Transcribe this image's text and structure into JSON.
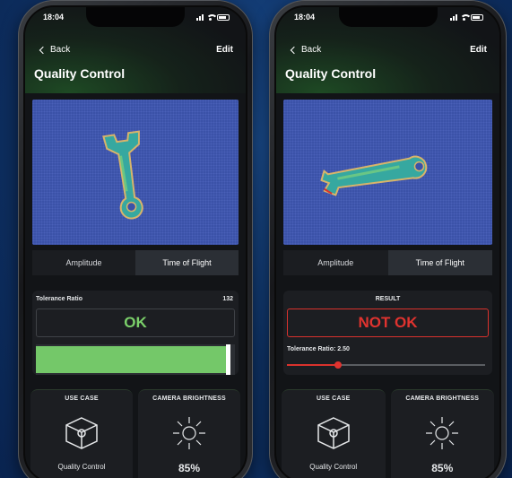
{
  "phones": [
    {
      "status": {
        "time": "18:04"
      },
      "nav": {
        "back_label": "Back",
        "edit_label": "Edit"
      },
      "title": "Quality Control",
      "tabs": [
        {
          "label": "Amplitude",
          "active": false
        },
        {
          "label": "Time of Flight",
          "active": true
        }
      ],
      "panel": {
        "label": "Tolerance Ratio",
        "value": "132",
        "result": "OK",
        "progress": 0.97
      },
      "cards": [
        {
          "title": "USE CASE",
          "text": "Quality Control",
          "icon": "cube-icon"
        },
        {
          "title": "CAMERA BRIGHTNESS",
          "text": "85%",
          "icon": "sun-icon"
        }
      ]
    },
    {
      "status": {
        "time": "18:04"
      },
      "nav": {
        "back_label": "Back",
        "edit_label": "Edit"
      },
      "title": "Quality Control",
      "tabs": [
        {
          "label": "Amplitude",
          "active": false
        },
        {
          "label": "Time of Flight",
          "active": true
        }
      ],
      "panel": {
        "label": "RESULT",
        "result": "NOT OK",
        "ratio_label": "Tolerance Ratio: 2.50",
        "slider_value": 0.26
      },
      "cards": [
        {
          "title": "USE CASE",
          "text": "Quality Control",
          "icon": "cube-icon"
        },
        {
          "title": "CAMERA BRIGHTNESS",
          "text": "85%",
          "icon": "sun-icon"
        }
      ]
    }
  ],
  "colors": {
    "background": "#0f3468",
    "ok_green": "#7bd06a",
    "not_ok_red": "#e0332f",
    "image_blue": "#3b52a8"
  }
}
